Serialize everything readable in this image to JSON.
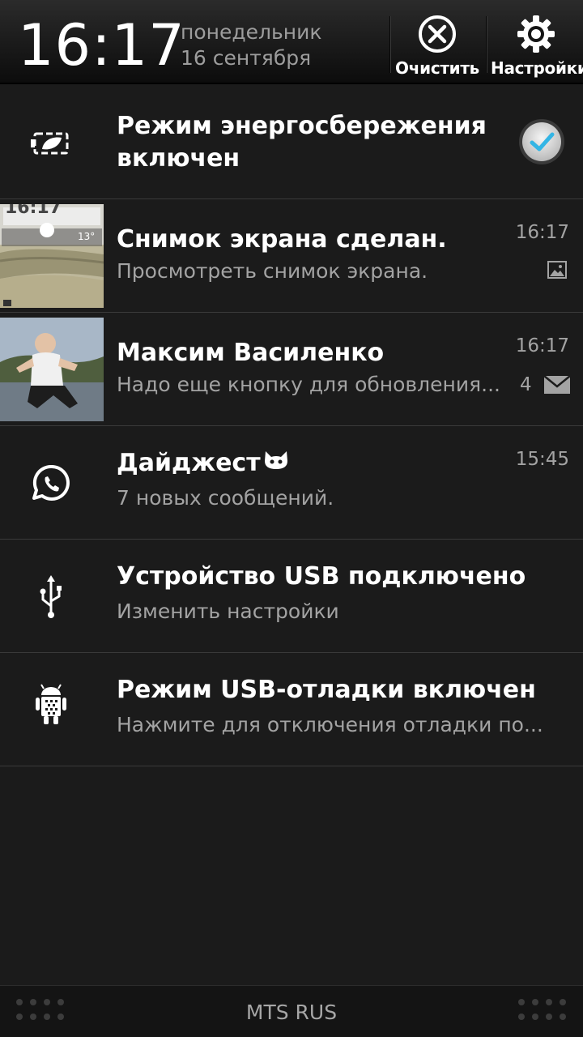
{
  "header": {
    "time": "16:17",
    "weekday": "понедельник",
    "date": "16 сентября",
    "clear_label": "Очистить",
    "settings_label": "Настройки"
  },
  "notifications": [
    {
      "title_line1": "Режим энергосбережения",
      "title_line2": "включен",
      "icon": "battery-leaf-icon",
      "checked": true
    },
    {
      "title": "Снимок экрана сделан.",
      "subtitle": "Просмотреть снимок экрана.",
      "time": "16:17",
      "status_icon": "picture-icon",
      "thumb_clock": "16:17",
      "thumb_temp": "13°"
    },
    {
      "title": "Максим Василенко",
      "subtitle": "Надо еще кнопку для обновления...",
      "time": "16:17",
      "count": "4",
      "status_icon": "mail-icon"
    },
    {
      "title": "Дайджест",
      "subtitle": "7 новых сообщений.",
      "time": "15:45",
      "icon": "whatsapp-icon",
      "emoji": "cat-face-icon"
    },
    {
      "title": "Устройство USB подключено",
      "subtitle": "Изменить настройки",
      "icon": "usb-icon"
    },
    {
      "title": "Режим USB-отладки включен",
      "subtitle": "Нажмите для отключения отладки по...",
      "icon": "android-debug-icon"
    }
  ],
  "bottom": {
    "carrier": "MTS RUS"
  },
  "colors": {
    "background": "#1b1b1b",
    "accent_check": "#33b5e5",
    "secondary_text": "#a3a3a3"
  }
}
